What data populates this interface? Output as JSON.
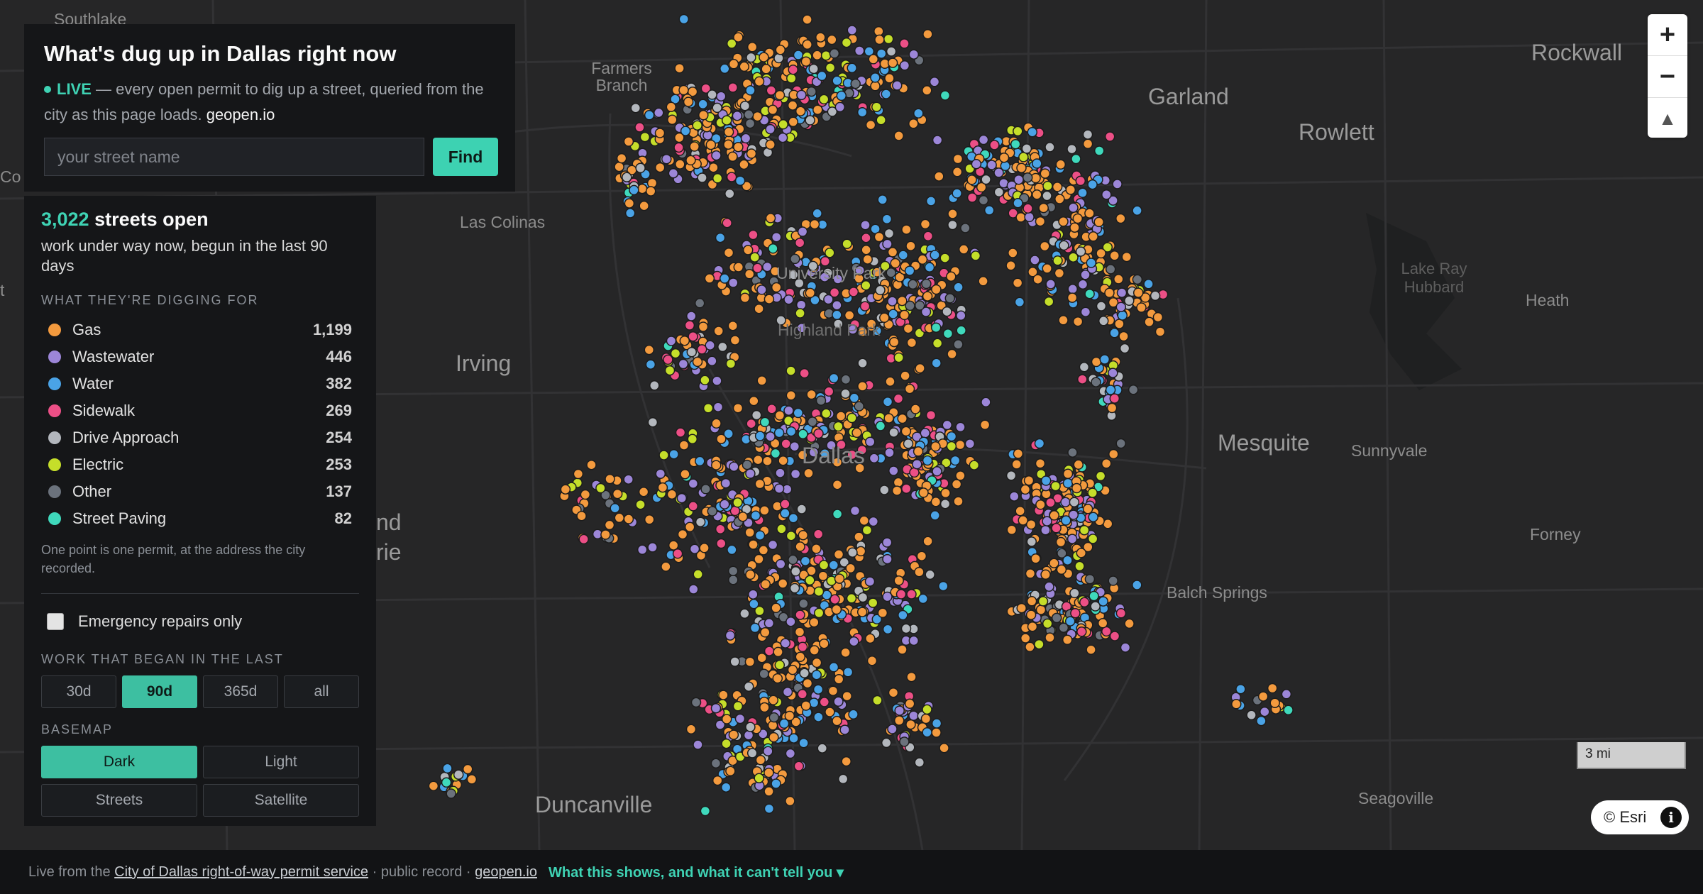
{
  "header": {
    "title": "What's dug up in Dallas right now",
    "live_badge": "LIVE",
    "live_text": " — every open permit to dig up a street, queried from the city as this page loads.",
    "brand": "geopen.io",
    "search_placeholder": "your street name",
    "find_label": "Find"
  },
  "summary": {
    "count": "3,022",
    "count_suffix": "streets open",
    "description": "work under way now, begun in the last 90 days"
  },
  "legend": {
    "heading": "WHAT THEY'RE DIGGING FOR",
    "items": [
      {
        "label": "Gas",
        "count": "1,199",
        "color": "#f39a3e"
      },
      {
        "label": "Wastewater",
        "count": "446",
        "color": "#9c86d8"
      },
      {
        "label": "Water",
        "count": "382",
        "color": "#4aa3e6"
      },
      {
        "label": "Sidewalk",
        "count": "269",
        "color": "#ec4f86"
      },
      {
        "label": "Drive Approach",
        "count": "254",
        "color": "#b3b7bd"
      },
      {
        "label": "Electric",
        "count": "253",
        "color": "#c5de2a"
      },
      {
        "label": "Other",
        "count": "137",
        "color": "#6b727c"
      },
      {
        "label": "Street Paving",
        "count": "82",
        "color": "#3fd9bc"
      }
    ],
    "note": "One point is one permit, at the address the city recorded."
  },
  "filters": {
    "emergency_label": "Emergency repairs only",
    "emergency_checked": false,
    "range_heading": "WORK THAT BEGAN IN THE LAST",
    "ranges": [
      "30d",
      "90d",
      "365d",
      "all"
    ],
    "selected_range": "90d",
    "basemap_heading": "BASEMAP",
    "basemaps": [
      "Dark",
      "Light",
      "Streets",
      "Satellite"
    ],
    "selected_basemap": "Dark"
  },
  "map": {
    "labels": {
      "southlake": "Southlake",
      "farmers_branch": "Farmers Branch",
      "garland": "Garland",
      "rockwall": "Rockwall",
      "rowlett": "Rowlett",
      "las_colinas": "Las Colinas",
      "university_park": "University Park",
      "lake_ray_hubbard": "Lake Ray Hubbard",
      "heath": "Heath",
      "highland_park": "Highland Park",
      "irving": "Irving",
      "dallas": "Dallas",
      "mesquite": "Mesquite",
      "sunnyvale": "Sunnyvale",
      "grand_prairie_fragment_1": "nd",
      "grand_prairie_fragment_2": "rie",
      "forney": "Forney",
      "balch_springs": "Balch Springs",
      "duncanville": "Duncanville",
      "seagoville": "Seagoville",
      "left_edge_fragment_1": "Co",
      "left_edge_fragment_2": "t"
    },
    "zoom_in": "+",
    "zoom_out": "−",
    "compass": "▲",
    "scale": "3 mi",
    "attribution": "© Esri",
    "info_icon": "i"
  },
  "footer": {
    "prefix": "Live from the",
    "source_link": "City of Dallas right-of-way permit service",
    "middle": "· public record ·",
    "brand_link": "geopen.io",
    "cta": "What this shows, and what it can't tell you ▾"
  }
}
